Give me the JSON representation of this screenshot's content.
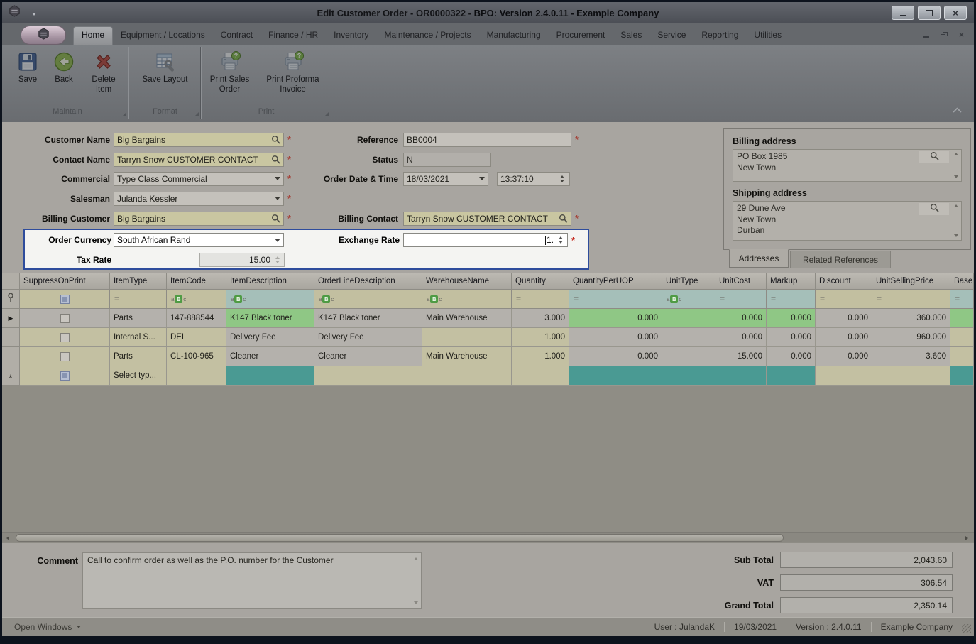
{
  "window": {
    "title_prefix": "Edit Customer Order - OR0000322 - ",
    "title_main": "BPO: Version 2.4.0.11 - Example Company"
  },
  "ribbon": {
    "tabs": [
      "Home",
      "Equipment / Locations",
      "Contract",
      "Finance / HR",
      "Inventory",
      "Maintenance / Projects",
      "Manufacturing",
      "Procurement",
      "Sales",
      "Service",
      "Reporting",
      "Utilities"
    ],
    "active_tab": "Home",
    "groups": [
      {
        "label": "Maintain",
        "buttons": [
          {
            "label": "Save",
            "icon": "save-icon"
          },
          {
            "label": "Back",
            "icon": "back-icon"
          },
          {
            "label": "Delete Item",
            "icon": "delete-icon"
          }
        ]
      },
      {
        "label": "Format",
        "buttons": [
          {
            "label": "Save Layout",
            "icon": "save-layout-icon"
          }
        ]
      },
      {
        "label": "Print",
        "buttons": [
          {
            "label": "Print Sales Order",
            "icon": "print-help-icon"
          },
          {
            "label": "Print Proforma Invoice",
            "icon": "print-help-icon"
          }
        ]
      }
    ]
  },
  "form": {
    "fields": {
      "customer_name": {
        "label": "Customer Name",
        "value": "Big Bargains",
        "required": true
      },
      "contact_name": {
        "label": "Contact Name",
        "value": "Tarryn Snow CUSTOMER CONTACT",
        "required": true
      },
      "commercial": {
        "label": "Commercial",
        "value": "Type Class Commercial",
        "required": true
      },
      "salesman": {
        "label": "Salesman",
        "value": "Julanda Kessler",
        "required": true
      },
      "billing_customer": {
        "label": "Billing Customer",
        "value": "Big Bargains",
        "required": true
      },
      "reference": {
        "label": "Reference",
        "value": "BB0004",
        "required": true
      },
      "status": {
        "label": "Status",
        "value": "N"
      },
      "order_datetime": {
        "label": "Order Date & Time",
        "date": "18/03/2021",
        "time": "13:37:10"
      },
      "billing_contact": {
        "label": "Billing Contact",
        "value": "Tarryn Snow CUSTOMER CONTACT",
        "required": true
      },
      "order_currency": {
        "label": "Order Currency",
        "value": "South African Rand"
      },
      "exchange_rate": {
        "label": "Exchange Rate",
        "value": "1.",
        "required": true
      },
      "tax_rate": {
        "label": "Tax Rate",
        "value": "15.00"
      }
    }
  },
  "addresses": {
    "billing": {
      "label": "Billing address",
      "lines": [
        "PO Box 1985",
        "New Town"
      ]
    },
    "shipping": {
      "label": "Shipping address",
      "lines": [
        "29 Dune Ave",
        "New Town",
        "Durban"
      ]
    },
    "tabs": [
      "Addresses",
      "Related References"
    ],
    "active_tab": "Addresses"
  },
  "grid": {
    "columns": [
      {
        "label": "SuppressOnPrint",
        "filter": "checkbox"
      },
      {
        "label": "ItemType",
        "filter": "eq"
      },
      {
        "label": "ItemCode",
        "filter": "abc"
      },
      {
        "label": "ItemDescription",
        "filter": "abc",
        "filter_teal": true
      },
      {
        "label": "OrderLineDescription",
        "filter": "abc"
      },
      {
        "label": "WarehouseName",
        "filter": "abc"
      },
      {
        "label": "Quantity",
        "filter": "eq"
      },
      {
        "label": "QuantityPerUOP",
        "filter": "eq",
        "filter_teal": true
      },
      {
        "label": "UnitType",
        "filter": "abc",
        "filter_teal": true
      },
      {
        "label": "UnitCost",
        "filter": "eq",
        "filter_teal": true
      },
      {
        "label": "Markup",
        "filter": "eq",
        "filter_teal": true
      },
      {
        "label": "Discount",
        "filter": "eq"
      },
      {
        "label": "UnitSellingPrice",
        "filter": "eq"
      },
      {
        "label": "Base",
        "filter": "eq",
        "filter_teal": true
      }
    ],
    "rows": [
      {
        "indicator": "current",
        "suppress": {
          "bg": "gray",
          "checked": false
        },
        "cells": [
          {
            "v": "Parts",
            "bg": "gray"
          },
          {
            "v": "147-888544",
            "bg": "gray"
          },
          {
            "v": "K147 Black toner",
            "bg": "green"
          },
          {
            "v": "K147 Black toner",
            "bg": "gray"
          },
          {
            "v": "Main Warehouse",
            "bg": "gray"
          },
          {
            "v": "3.000",
            "bg": "gray"
          },
          {
            "v": "0.000",
            "bg": "green"
          },
          {
            "v": "",
            "bg": "green"
          },
          {
            "v": "0.000",
            "bg": "green"
          },
          {
            "v": "0.000",
            "bg": "green"
          },
          {
            "v": "0.000",
            "bg": "gray"
          },
          {
            "v": "360.000",
            "bg": "gray"
          },
          {
            "v": "",
            "bg": "green"
          }
        ]
      },
      {
        "indicator": "",
        "suppress": {
          "bg": "beige",
          "checked": false
        },
        "cells": [
          {
            "v": "Internal S...",
            "bg": "beige"
          },
          {
            "v": "DEL",
            "bg": "beige"
          },
          {
            "v": "Delivery Fee",
            "bg": "gray"
          },
          {
            "v": "Delivery Fee",
            "bg": "gray"
          },
          {
            "v": "",
            "bg": "beige"
          },
          {
            "v": "1.000",
            "bg": "beige"
          },
          {
            "v": "0.000",
            "bg": "gray"
          },
          {
            "v": "",
            "bg": "gray"
          },
          {
            "v": "0.000",
            "bg": "gray"
          },
          {
            "v": "0.000",
            "bg": "gray"
          },
          {
            "v": "0.000",
            "bg": "gray"
          },
          {
            "v": "960.000",
            "bg": "gray"
          },
          {
            "v": "",
            "bg": "beige"
          }
        ]
      },
      {
        "indicator": "",
        "suppress": {
          "bg": "beige",
          "checked": false
        },
        "cells": [
          {
            "v": "Parts",
            "bg": "beige"
          },
          {
            "v": "CL-100-965",
            "bg": "beige"
          },
          {
            "v": "Cleaner",
            "bg": "gray"
          },
          {
            "v": "Cleaner",
            "bg": "gray"
          },
          {
            "v": "Main Warehouse",
            "bg": "beige"
          },
          {
            "v": "1.000",
            "bg": "beige"
          },
          {
            "v": "0.000",
            "bg": "gray"
          },
          {
            "v": "",
            "bg": "gray"
          },
          {
            "v": "15.000",
            "bg": "gray"
          },
          {
            "v": "0.000",
            "bg": "gray"
          },
          {
            "v": "0.000",
            "bg": "gray"
          },
          {
            "v": "3.600",
            "bg": "gray"
          },
          {
            "v": "",
            "bg": "beige"
          }
        ]
      },
      {
        "indicator": "new",
        "suppress": {
          "bg": "beige",
          "checked": true
        },
        "cells": [
          {
            "v": "Select typ...",
            "bg": "beige"
          },
          {
            "v": "",
            "bg": "beige"
          },
          {
            "v": "",
            "bg": "teal"
          },
          {
            "v": "",
            "bg": "beige"
          },
          {
            "v": "",
            "bg": "beige"
          },
          {
            "v": "",
            "bg": "beige"
          },
          {
            "v": "",
            "bg": "teal"
          },
          {
            "v": "",
            "bg": "teal"
          },
          {
            "v": "",
            "bg": "teal"
          },
          {
            "v": "",
            "bg": "teal"
          },
          {
            "v": "",
            "bg": "beige"
          },
          {
            "v": "",
            "bg": "beige"
          },
          {
            "v": "",
            "bg": "teal"
          }
        ]
      }
    ]
  },
  "footer": {
    "comment_label": "Comment",
    "comment": "Call to confirm order as well as the  P.O. number for the Customer",
    "totals": [
      {
        "label": "Sub Total",
        "value": "2,043.60"
      },
      {
        "label": "VAT",
        "value": "306.54"
      },
      {
        "label": "Grand Total",
        "value": "2,350.14"
      }
    ]
  },
  "statusbar": {
    "open_windows": "Open Windows",
    "right_items": [
      "User : JulandaK",
      "19/03/2021",
      "Version : 2.4.0.11",
      "Example Company"
    ]
  },
  "colors": {
    "spotlight_border": "#2e4c9c",
    "highlight_green": "#8fc785",
    "selection_teal": "#4a9a93",
    "filter_teal": "#a5bfb9",
    "required_field_cream": "#c9c6a1",
    "required_asterisk": "#c5291f"
  }
}
